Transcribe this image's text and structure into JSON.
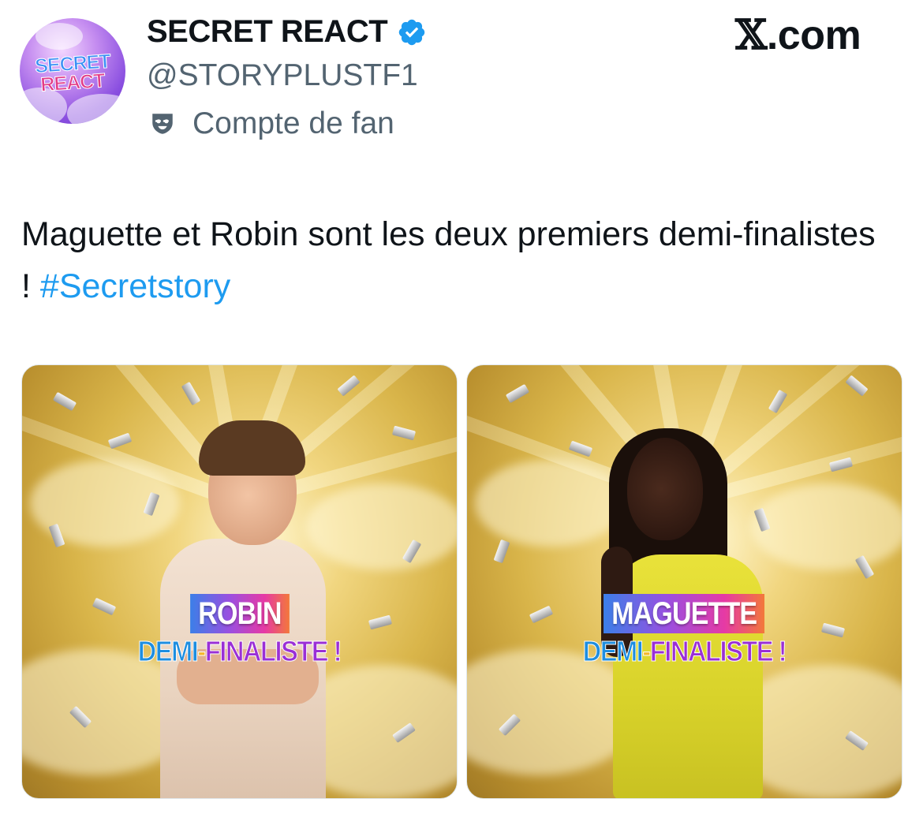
{
  "account": {
    "display_name": "SECRET REACT",
    "handle": "@STORYPLUSTF1",
    "fan_label": "Compte de fan",
    "verified": true,
    "verified_icon": "verified-badge-icon",
    "fan_icon": "theater-mask-icon",
    "avatar": {
      "line1": "SECRET",
      "line2": "REACT"
    }
  },
  "brand": {
    "x_glyph": "𝕏",
    "suffix": ".com"
  },
  "tweet": {
    "text": "Maguette et Robin sont les deux premiers demi-finalistes ! ",
    "hashtag": "#Secretstory"
  },
  "media": [
    {
      "name": "ROBIN",
      "demi": "DEMI",
      "dash": "-",
      "finaliste": "FINALISTE !"
    },
    {
      "name": "MAGUETTE",
      "demi": "DEMI",
      "dash": "-",
      "finaliste": "FINALISTE !"
    }
  ],
  "colors": {
    "text": "#0f1419",
    "secondary": "#536471",
    "link": "#1d9bf0",
    "verified": "#1d9bf0"
  }
}
